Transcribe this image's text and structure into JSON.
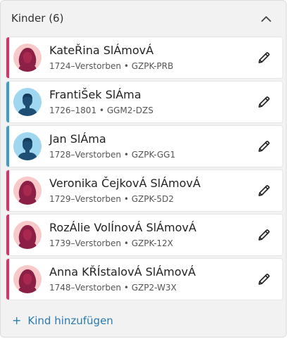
{
  "panel": {
    "title": "Kinder (6)",
    "collapse_icon": "chevron-up-icon"
  },
  "children": [
    {
      "name": "KateŘina SlÁmovÁ",
      "lifespan": "1724–Verstorben",
      "id": "GZPK-PRB",
      "sex": "female"
    },
    {
      "name": "FrantiŠek SlÁma",
      "lifespan": "1726–1801",
      "id": "GGM2-DZS",
      "sex": "male"
    },
    {
      "name": "Jan SlÁma",
      "lifespan": "1728–Verstorben",
      "id": "GZPK-GG1",
      "sex": "male"
    },
    {
      "name": "Veronika ČejkovÁ SlÁmovÁ",
      "lifespan": "1729–Verstorben",
      "id": "GZPK-5D2",
      "sex": "female"
    },
    {
      "name": "RozÁlie VolÍnovÁ SlÁmovÁ",
      "lifespan": "1739–Verstorben",
      "id": "GZPK-12X",
      "sex": "female"
    },
    {
      "name": "Anna KŘÍstalovÁ SlÁmovÁ",
      "lifespan": "1748–Verstorben",
      "id": "GZP2-W3X",
      "sex": "female"
    }
  ],
  "meta_separator": "•",
  "add_child": {
    "icon": "+",
    "label": "Kind hinzufügen"
  },
  "icons": {
    "edit": "pencil-icon",
    "female_avatar": "female-avatar-icon",
    "male_avatar": "male-avatar-icon"
  },
  "colors": {
    "female_accent": "#d6336c",
    "male_accent": "#3e9fc4",
    "link": "#2b7ab0"
  }
}
